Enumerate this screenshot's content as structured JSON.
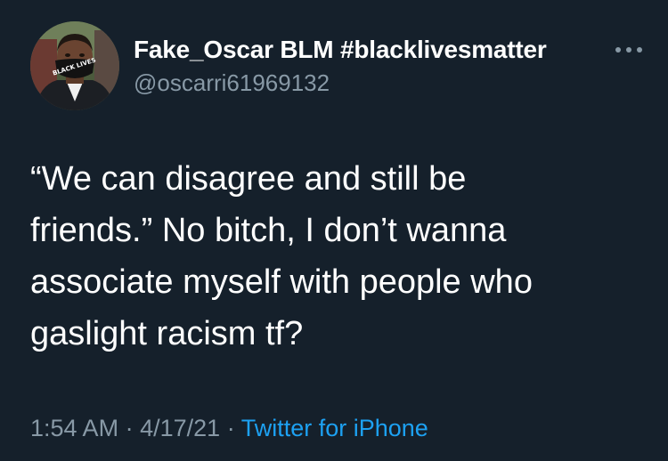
{
  "user": {
    "display_name": "Fake_Oscar BLM #blacklivesmatter",
    "handle": "@oscarri61969132",
    "avatar_mask_text": "BLACK LIVES MATTER"
  },
  "tweet": {
    "text": "“We can disagree and still be\nfriends.” No bitch, I don’t wanna\nassociate myself with people who\ngaslight racism tf?",
    "time": "1:54 AM",
    "date": "4/17/21",
    "separator": "·",
    "source": "Twitter for iPhone"
  },
  "colors": {
    "background": "#15202b",
    "text": "#ffffff",
    "muted": "#8899a6",
    "link": "#1da1f2"
  },
  "icons": {
    "more": "more-horizontal-icon"
  }
}
